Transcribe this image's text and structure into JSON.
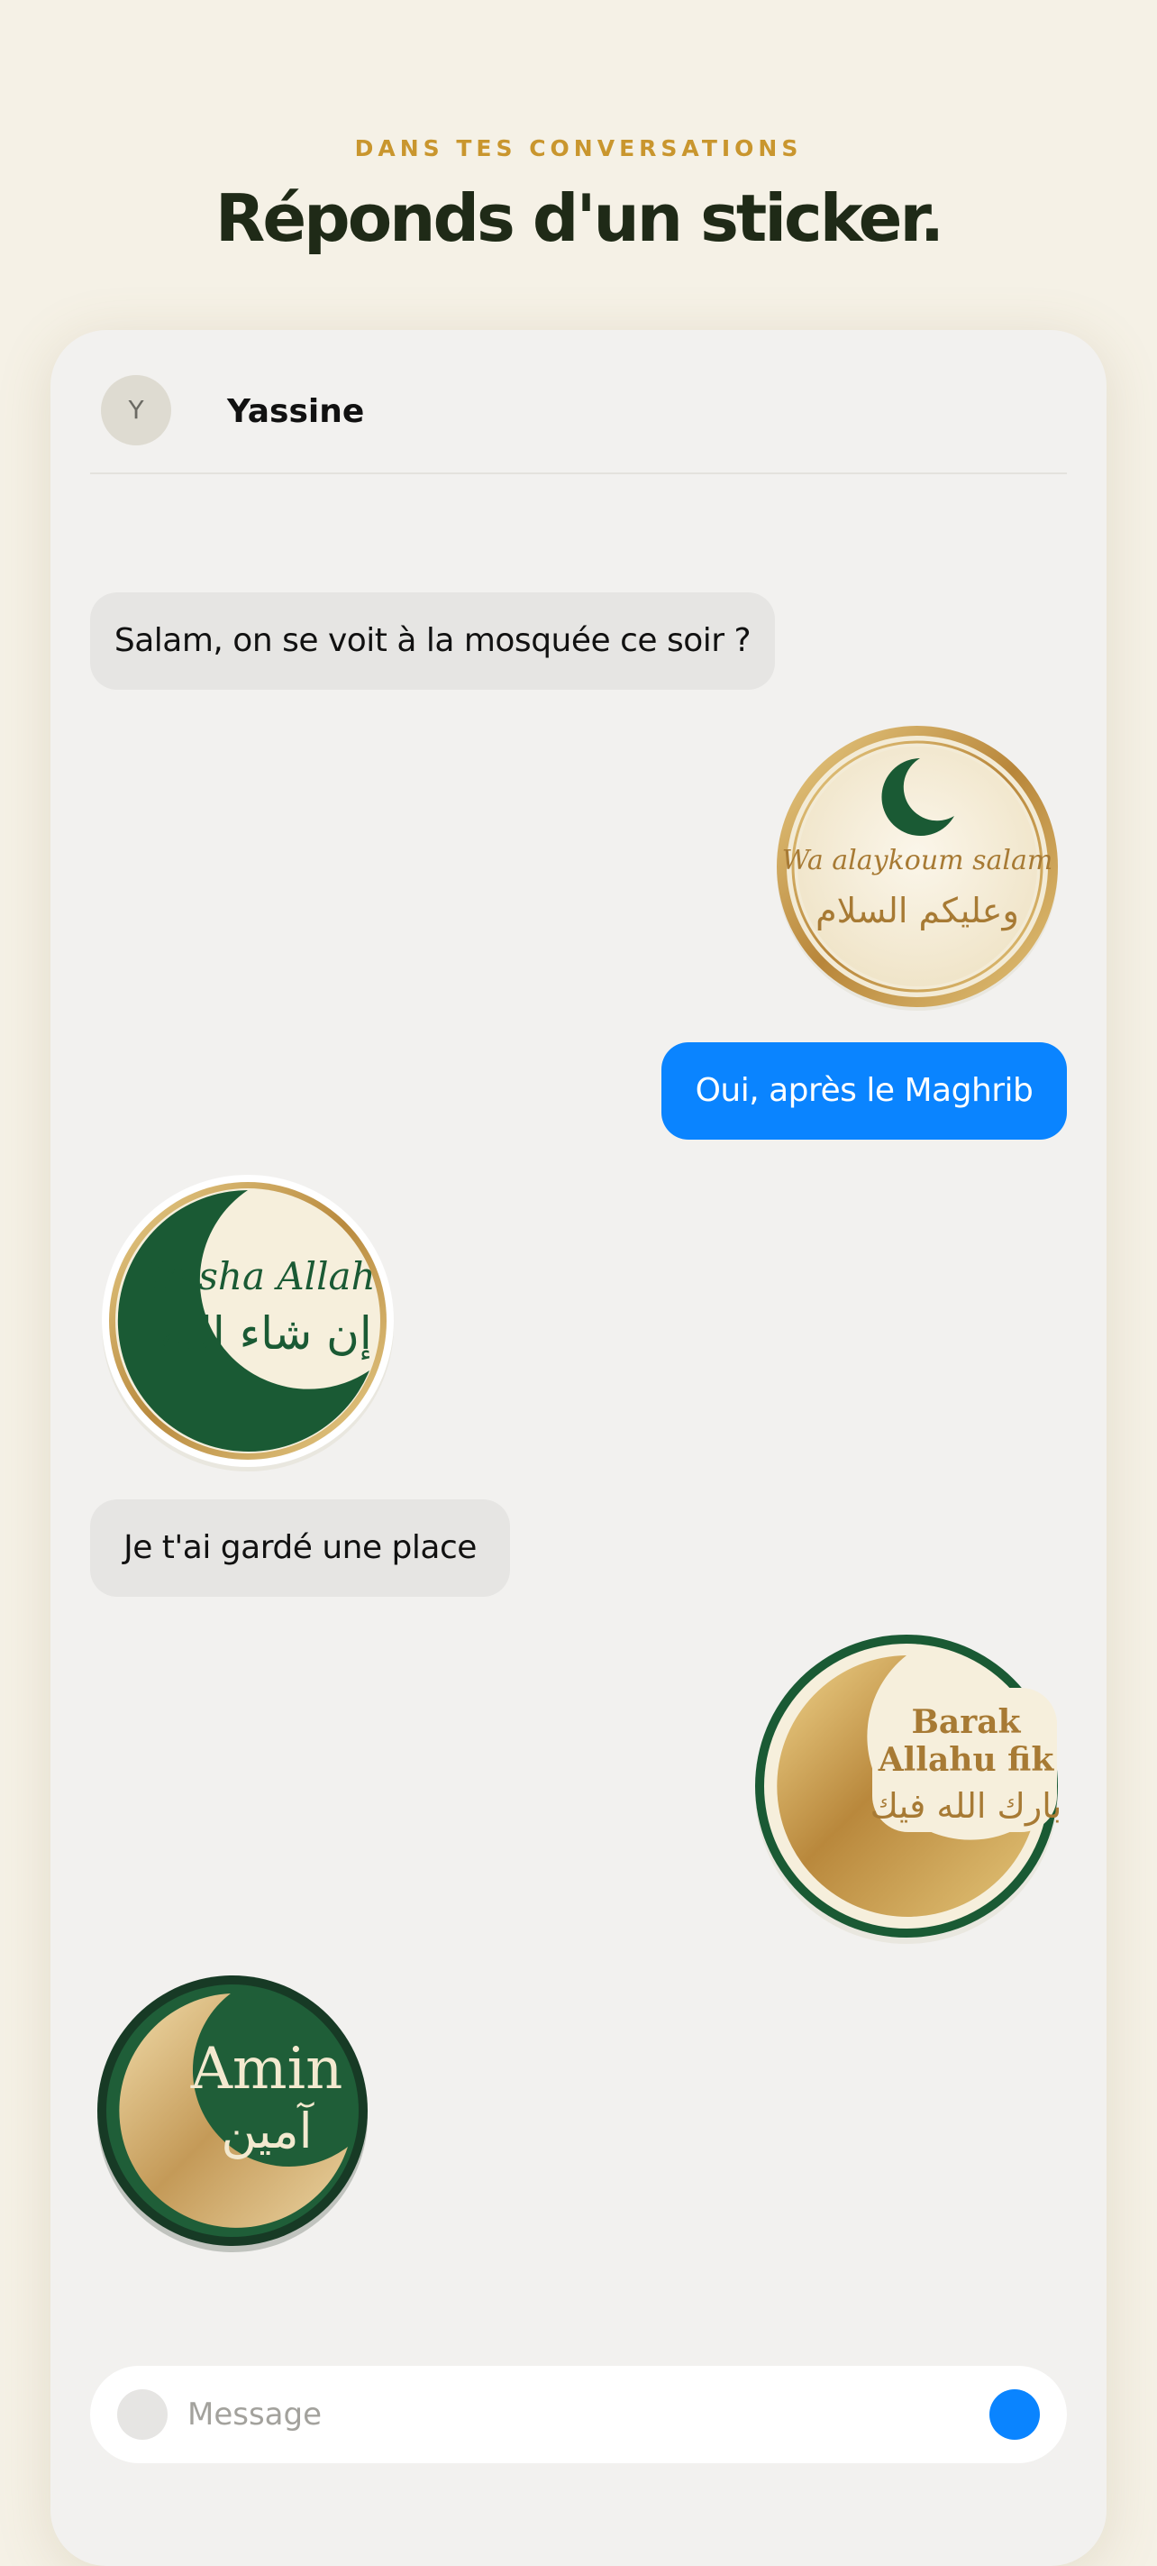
{
  "header": {
    "eyebrow": "DANS TES CONVERSATIONS",
    "headline": "Réponds d'un sticker."
  },
  "chat": {
    "contact_initial": "Y",
    "contact_name": "Yassine",
    "messages": [
      {
        "type": "text",
        "direction": "incoming",
        "text": "Salam, on se voit à la mosquée ce soir ?"
      },
      {
        "type": "sticker",
        "direction": "outgoing",
        "latin": "Wa alaykoum salam",
        "arabic": "وعليكم السلام"
      },
      {
        "type": "text",
        "direction": "outgoing",
        "text": "Oui, après le Maghrib"
      },
      {
        "type": "sticker",
        "direction": "incoming",
        "latin": "In sha Allah",
        "arabic": "إن شاء الله"
      },
      {
        "type": "text",
        "direction": "incoming",
        "text": "Je t'ai gardé une place"
      },
      {
        "type": "sticker",
        "direction": "outgoing",
        "latin_line1": "Barak",
        "latin_line2": "Allahu fik",
        "arabic": "بارك الله فيك"
      },
      {
        "type": "sticker",
        "direction": "incoming",
        "latin": "Amin",
        "arabic": "آمين"
      }
    ]
  },
  "composer": {
    "placeholder": "Message"
  },
  "colors": {
    "page_background": "#f5f1e6",
    "accent_gold": "#c9962e",
    "headline": "#1f2a17",
    "outgoing_bubble": "#0a84ff",
    "incoming_bubble": "#e6e5e3",
    "islamic_green": "#1a5a34",
    "sticker_cream": "#f6efdc"
  },
  "icons": {
    "composer_attach": "plus-circle-icon",
    "send": "send-icon"
  }
}
